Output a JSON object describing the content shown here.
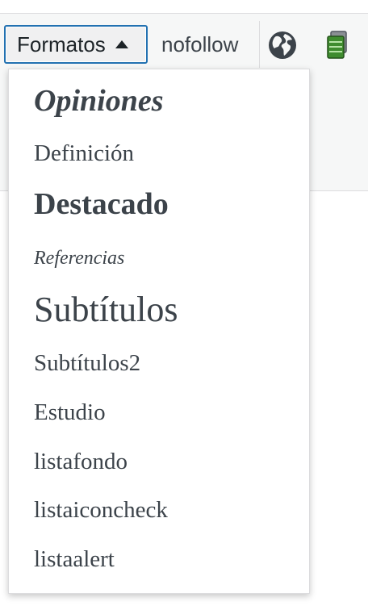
{
  "toolbar": {
    "formats_label": "Formatos",
    "nofollow_label": "nofollow",
    "icons": [
      "caret-up-icon",
      "globe-icon",
      "database-icon"
    ]
  },
  "colors": {
    "focus_border": "#2271b1",
    "text": "#3c434a",
    "toolbar_bg": "#f6f7f7",
    "db_icon_green": "#3f8c2f"
  },
  "formats_menu": {
    "items": [
      {
        "label": "Opiniones"
      },
      {
        "label": "Definición"
      },
      {
        "label": "Destacado"
      },
      {
        "label": "Referencias"
      },
      {
        "label": "Subtítulos"
      },
      {
        "label": "Subtítulos2"
      },
      {
        "label": "Estudio"
      },
      {
        "label": "listafondo"
      },
      {
        "label": "listaiconcheck"
      },
      {
        "label": "listaalert"
      }
    ]
  }
}
